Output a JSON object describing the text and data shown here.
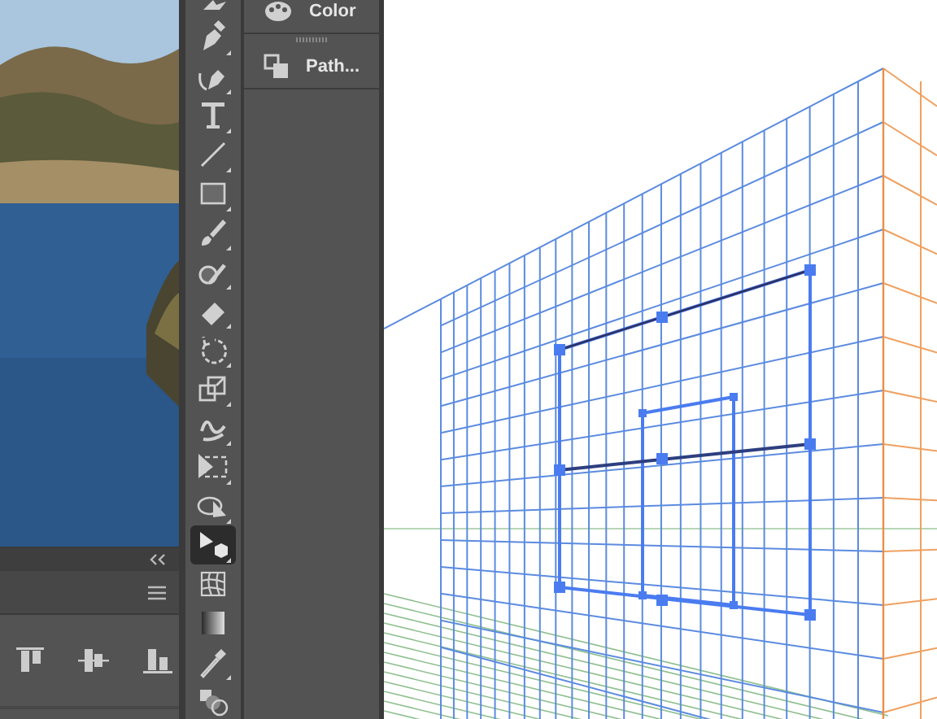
{
  "tools": [
    {
      "selected": false
    },
    {
      "selected": false,
      "flyout": true
    },
    {
      "selected": false,
      "flyout": true
    },
    {
      "selected": false,
      "flyout": true
    },
    {
      "selected": false,
      "flyout": true
    },
    {
      "selected": false,
      "flyout": true
    },
    {
      "selected": false,
      "flyout": true
    },
    {
      "selected": false,
      "flyout": true
    },
    {
      "selected": false,
      "flyout": true
    },
    {
      "selected": false,
      "flyout": true
    },
    {
      "selected": false,
      "flyout": true
    },
    {
      "selected": false,
      "flyout": true
    },
    {
      "selected": false,
      "flyout": true
    },
    {
      "selected": false,
      "flyout": true
    },
    {
      "selected": true,
      "flyout": true
    },
    {
      "selected": false,
      "flyout": false
    },
    {
      "selected": false,
      "flyout": false
    },
    {
      "selected": false,
      "flyout": true
    },
    {
      "selected": false,
      "flyout": false
    }
  ],
  "panels": [
    {
      "label": "Color"
    },
    {
      "label": "Path..."
    }
  ]
}
